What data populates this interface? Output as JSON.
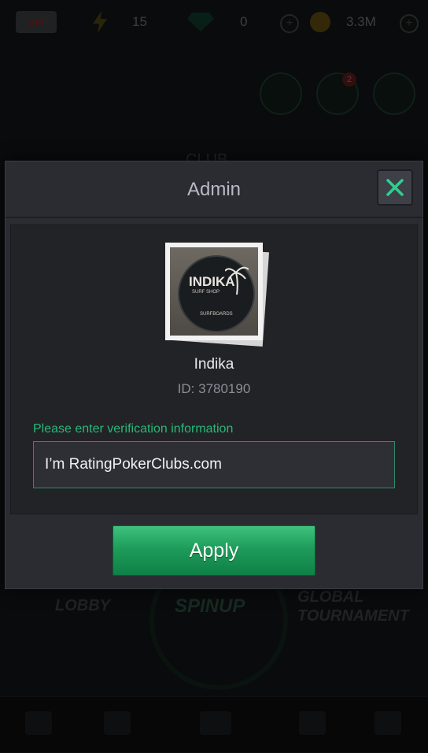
{
  "topbar": {
    "vip_label": "VIP",
    "energy": "15",
    "gems": "0",
    "coins": "3.3M"
  },
  "background": {
    "club_label": "CLUB",
    "notification_count": "2",
    "lobby_label": "LOBBY",
    "spinup_label": "SPINUP",
    "global_label_line1": "GLOBAL",
    "global_label_line2": "TOURNAMENT"
  },
  "modal": {
    "title": "Admin",
    "club_name": "Indika",
    "club_id": "ID: 3780190",
    "logo_text": "INDIKA",
    "logo_sub": "SURF SHOP",
    "logo_sub2": "SURFBOARDS",
    "verify_label": "Please enter verification information",
    "verify_value": "I’m RatingPokerClubs.com",
    "apply_label": "Apply"
  },
  "colors": {
    "accent_green": "#27b877",
    "button_green": "#1e9c5a",
    "close_x": "#2fcf8f"
  }
}
